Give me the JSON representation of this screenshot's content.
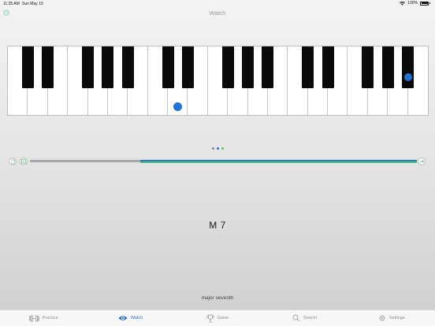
{
  "status_bar": {
    "time": "11:35 AM",
    "date": "Sun May 19",
    "battery": "100%"
  },
  "nav": {
    "title": "Watch"
  },
  "keyboard": {
    "white_key_count": 21,
    "black_keys_after_white_index": [
      0,
      1,
      3,
      4,
      5,
      7,
      8,
      10,
      11,
      12,
      14,
      15,
      17,
      18,
      19
    ],
    "highlighted_white_keys": [
      8
    ],
    "highlighted_black_keys": [
      14
    ],
    "highlight_color": "#1e73d8"
  },
  "page_indicator": {
    "count": 3,
    "active_index": 1,
    "colors": [
      "#8a8a8a",
      "#1e73d8",
      "#43c36b"
    ]
  },
  "chord": {
    "symbol": "M 7",
    "name": "major seventh"
  },
  "tabs": [
    {
      "label": "Practice",
      "icon": "dumbbell-icon",
      "active": false
    },
    {
      "label": "Watch",
      "icon": "eye-icon",
      "active": true
    },
    {
      "label": "Game",
      "icon": "trophy-icon",
      "active": false
    },
    {
      "label": "Search",
      "icon": "search-icon",
      "active": false
    },
    {
      "label": "Settings",
      "icon": "gear-icon",
      "active": false
    }
  ],
  "colors": {
    "accent": "#1e73d8",
    "green": "#43c36b"
  }
}
